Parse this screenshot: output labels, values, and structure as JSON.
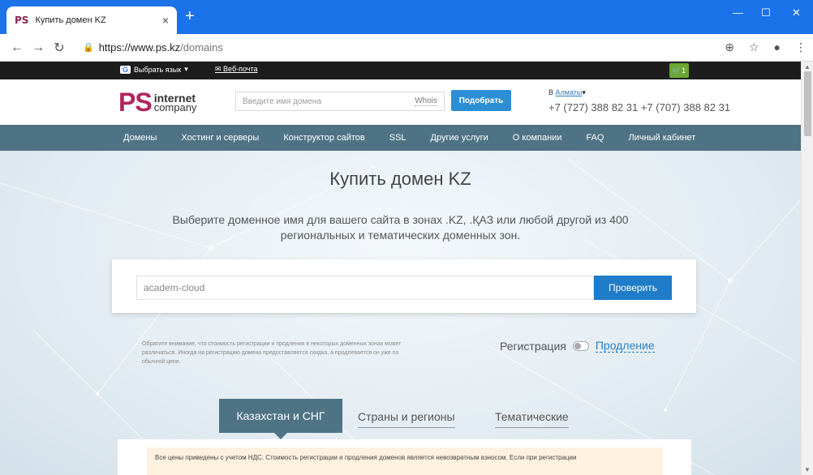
{
  "browser": {
    "tab_favicon": "PS",
    "tab_title": "Купить домен KZ",
    "tab_close": "×",
    "new_tab": "+",
    "url_host": "https://www.ps.kz",
    "url_path": "/domains",
    "minimize": "—",
    "maximize": "☐",
    "close": "✕"
  },
  "topstrip": {
    "lang_label": "Выбрать язык",
    "webmail": "Веб-почта",
    "cart_count": "1"
  },
  "header": {
    "logo_ps": "PS",
    "logo_line1": "internet",
    "logo_line2": "company",
    "search_placeholder": "Введите имя домена",
    "whois": "Whois",
    "pick_button": "Подобрать",
    "city_prefix": "В",
    "city": "Алматы",
    "phones": "+7 (727) 388 82 31 +7 (707) 388 82 31"
  },
  "nav": {
    "items": [
      "Домены",
      "Хостинг и серверы",
      "Конструктор сайтов",
      "SSL",
      "Другие услуги",
      "О компании",
      "FAQ",
      "Личный кабинет"
    ]
  },
  "hero": {
    "title": "Купить домен KZ",
    "subtitle": "Выберите доменное имя для вашего сайта в зонах .KZ, .ҚАЗ или любой другой из 400 региональных и тематических доменных зон.",
    "input_value": "academ-cloud",
    "check_button": "Проверить",
    "notice": "Обратите внимание, что стоимость регистрации и продления в некоторых доменных зонах может различаться. Иногда на регистрацию домена предоставляется скидка, а продлевается он уже по обычной цене.",
    "registration": "Регистрация",
    "renewal": "Продление"
  },
  "zone_tabs": [
    "Казахстан и СНГ",
    "Страны и регионы",
    "Тематические"
  ],
  "vat_notice": "Все цены приведены с учетом НДС. Стоимость регистрации и продления доменов является невозвратным взносом. Если при регистрации",
  "colors": {
    "brand": "#b1245e",
    "nav": "#4e7384",
    "button": "#2c8fd6",
    "chrome": "#1a73e8"
  }
}
